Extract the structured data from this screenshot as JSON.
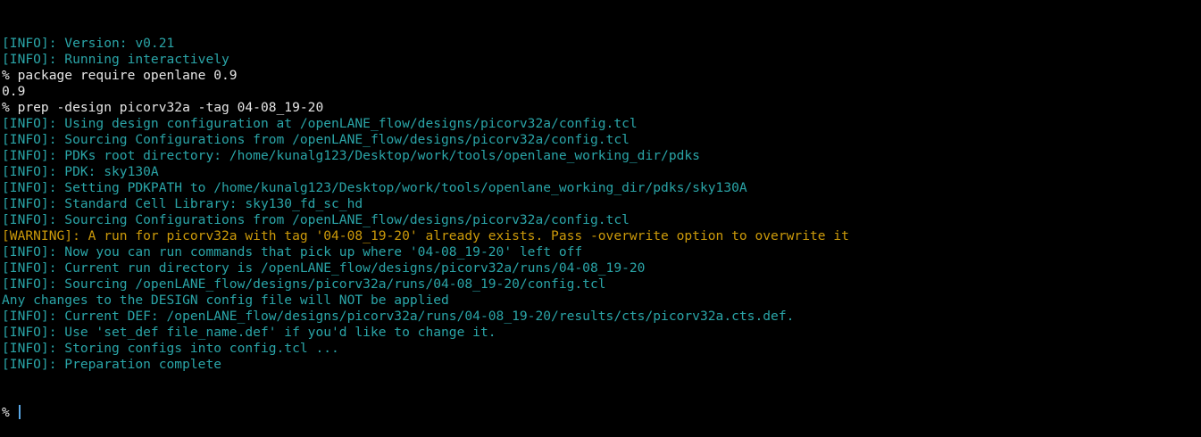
{
  "terminal": {
    "colors": {
      "background": "#000000",
      "info": "#2aa5a8",
      "warning": "#cc9a0a",
      "plain": "#e6e6e6",
      "cursor": "#5aa8e6"
    },
    "lines": [
      {
        "type": "info",
        "text": "[INFO]: Version: v0.21"
      },
      {
        "type": "info",
        "text": "[INFO]: Running interactively"
      },
      {
        "type": "plain",
        "text": "% package require openlane 0.9"
      },
      {
        "type": "plain",
        "text": "0.9"
      },
      {
        "type": "plain",
        "text": "% prep -design picorv32a -tag 04-08_19-20"
      },
      {
        "type": "info",
        "text": "[INFO]: Using design configuration at /openLANE_flow/designs/picorv32a/config.tcl"
      },
      {
        "type": "info",
        "text": "[INFO]: Sourcing Configurations from /openLANE_flow/designs/picorv32a/config.tcl"
      },
      {
        "type": "info",
        "text": "[INFO]: PDKs root directory: /home/kunalg123/Desktop/work/tools/openlane_working_dir/pdks"
      },
      {
        "type": "info",
        "text": "[INFO]: PDK: sky130A"
      },
      {
        "type": "info",
        "text": "[INFO]: Setting PDKPATH to /home/kunalg123/Desktop/work/tools/openlane_working_dir/pdks/sky130A"
      },
      {
        "type": "info",
        "text": "[INFO]: Standard Cell Library: sky130_fd_sc_hd"
      },
      {
        "type": "info",
        "text": "[INFO]: Sourcing Configurations from /openLANE_flow/designs/picorv32a/config.tcl"
      },
      {
        "type": "warn",
        "text": "[WARNING]: A run for picorv32a with tag '04-08_19-20' already exists. Pass -overwrite option to overwrite it"
      },
      {
        "type": "info",
        "text": "[INFO]: Now you can run commands that pick up where '04-08_19-20' left off"
      },
      {
        "type": "info",
        "text": "[INFO]: Current run directory is /openLANE_flow/designs/picorv32a/runs/04-08_19-20"
      },
      {
        "type": "info",
        "text": "[INFO]: Sourcing /openLANE_flow/designs/picorv32a/runs/04-08_19-20/config.tcl"
      },
      {
        "type": "info",
        "text": "Any changes to the DESIGN config file will NOT be applied"
      },
      {
        "type": "info",
        "text": "[INFO]: Current DEF: /openLANE_flow/designs/picorv32a/runs/04-08_19-20/results/cts/picorv32a.cts.def."
      },
      {
        "type": "info",
        "text": "[INFO]: Use 'set_def file_name.def' if you'd like to change it."
      },
      {
        "type": "info",
        "text": "[INFO]: Storing configs into config.tcl ..."
      },
      {
        "type": "info",
        "text": "[INFO]: Preparation complete"
      }
    ],
    "prompt": "% "
  }
}
